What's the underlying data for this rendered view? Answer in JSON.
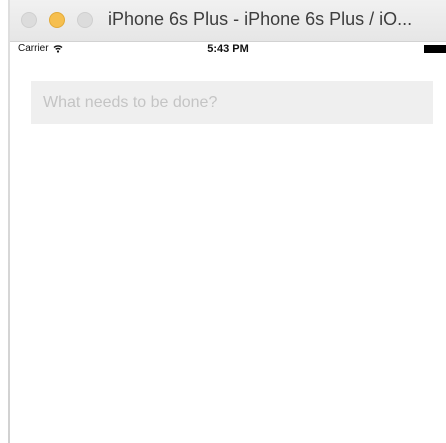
{
  "window": {
    "title": "iPhone 6s Plus - iPhone 6s Plus / iO..."
  },
  "status_bar": {
    "carrier": "Carrier",
    "time": "5:43 PM"
  },
  "todo": {
    "placeholder": "What needs to be done?"
  },
  "colors": {
    "minimize_button": "#f6bf4f",
    "input_background": "#efefef",
    "placeholder_text": "#c4c4c4"
  },
  "icons": {
    "wifi": "wifi-icon",
    "battery": "battery-icon"
  }
}
